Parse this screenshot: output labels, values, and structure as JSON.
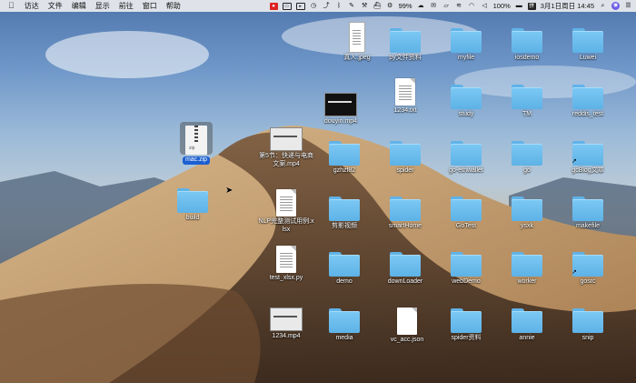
{
  "menubar": {
    "apple_icon": "apple-icon",
    "menus": [
      "访达",
      "文件",
      "编辑",
      "显示",
      "前往",
      "窗口",
      "帮助"
    ],
    "battery": "99%",
    "battery_full": "100%",
    "date_time": "3月1日周日 14:45"
  },
  "desktop": {
    "icons": [
      {
        "id": "renlian",
        "label": "真人.jpeg",
        "kind": "tall-doc"
      },
      {
        "id": "py-wenjian",
        "label": "py文件资料",
        "kind": "folder"
      },
      {
        "id": "myfile",
        "label": "myfile",
        "kind": "folder"
      },
      {
        "id": "iosdemo",
        "label": "iosdemo",
        "kind": "folder"
      },
      {
        "id": "luwei",
        "label": "Luwei",
        "kind": "folder"
      },
      {
        "id": "douyin",
        "label": "douyin.mp4",
        "kind": "video-dark"
      },
      {
        "id": "txt1234",
        "label": "1234.txt",
        "kind": "doc"
      },
      {
        "id": "study",
        "label": "study",
        "kind": "folder"
      },
      {
        "id": "tm",
        "label": "TM",
        "kind": "folder"
      },
      {
        "id": "reddis",
        "label": "reddis_test",
        "kind": "folder"
      },
      {
        "id": "macdzip",
        "label": "mac.zip",
        "kind": "zip",
        "selected": true
      },
      {
        "id": "lesson5",
        "label": "第5节：快递与电商文案.mp4",
        "kind": "video-light"
      },
      {
        "id": "gzhzf",
        "label": "gzhzf82",
        "kind": "folder"
      },
      {
        "id": "spider",
        "label": "spider",
        "kind": "folder"
      },
      {
        "id": "goethwallet",
        "label": "go-ethwallet",
        "kind": "folder"
      },
      {
        "id": "go",
        "label": "go",
        "kind": "folder"
      },
      {
        "id": "gcblog",
        "label": "gcBlog文章",
        "kind": "folder",
        "alias": true
      },
      {
        "id": "build",
        "label": "build",
        "kind": "folder"
      },
      {
        "id": "nlp",
        "label": "NLP完整测试用例.xlsx",
        "kind": "doc"
      },
      {
        "id": "jianying",
        "label": "剪影视频",
        "kind": "folder"
      },
      {
        "id": "smarthome",
        "label": "smartHome",
        "kind": "folder"
      },
      {
        "id": "gotest",
        "label": "GoTest",
        "kind": "folder"
      },
      {
        "id": "ysxk",
        "label": "ysxk",
        "kind": "folder"
      },
      {
        "id": "makefile",
        "label": "makefile",
        "kind": "folder"
      },
      {
        "id": "testxlsxpy",
        "label": "test_xlsx.py",
        "kind": "doc-python"
      },
      {
        "id": "demo",
        "label": "demo",
        "kind": "folder"
      },
      {
        "id": "downloader",
        "label": "downLoader",
        "kind": "folder"
      },
      {
        "id": "webdemo",
        "label": "webDemo",
        "kind": "folder"
      },
      {
        "id": "worker",
        "label": "worker",
        "kind": "folder"
      },
      {
        "id": "gosrc",
        "label": "gosrc",
        "kind": "folder",
        "alias": true
      },
      {
        "id": "mp41234",
        "label": "1234.mp4",
        "kind": "video-light"
      },
      {
        "id": "media",
        "label": "media",
        "kind": "folder"
      },
      {
        "id": "vcacc",
        "label": "vc_acc.json",
        "kind": "blank-doc"
      },
      {
        "id": "spiderziliao",
        "label": "spider资料",
        "kind": "folder"
      },
      {
        "id": "annie",
        "label": "annie",
        "kind": "folder"
      },
      {
        "id": "snip",
        "label": "snip",
        "kind": "folder"
      }
    ]
  }
}
